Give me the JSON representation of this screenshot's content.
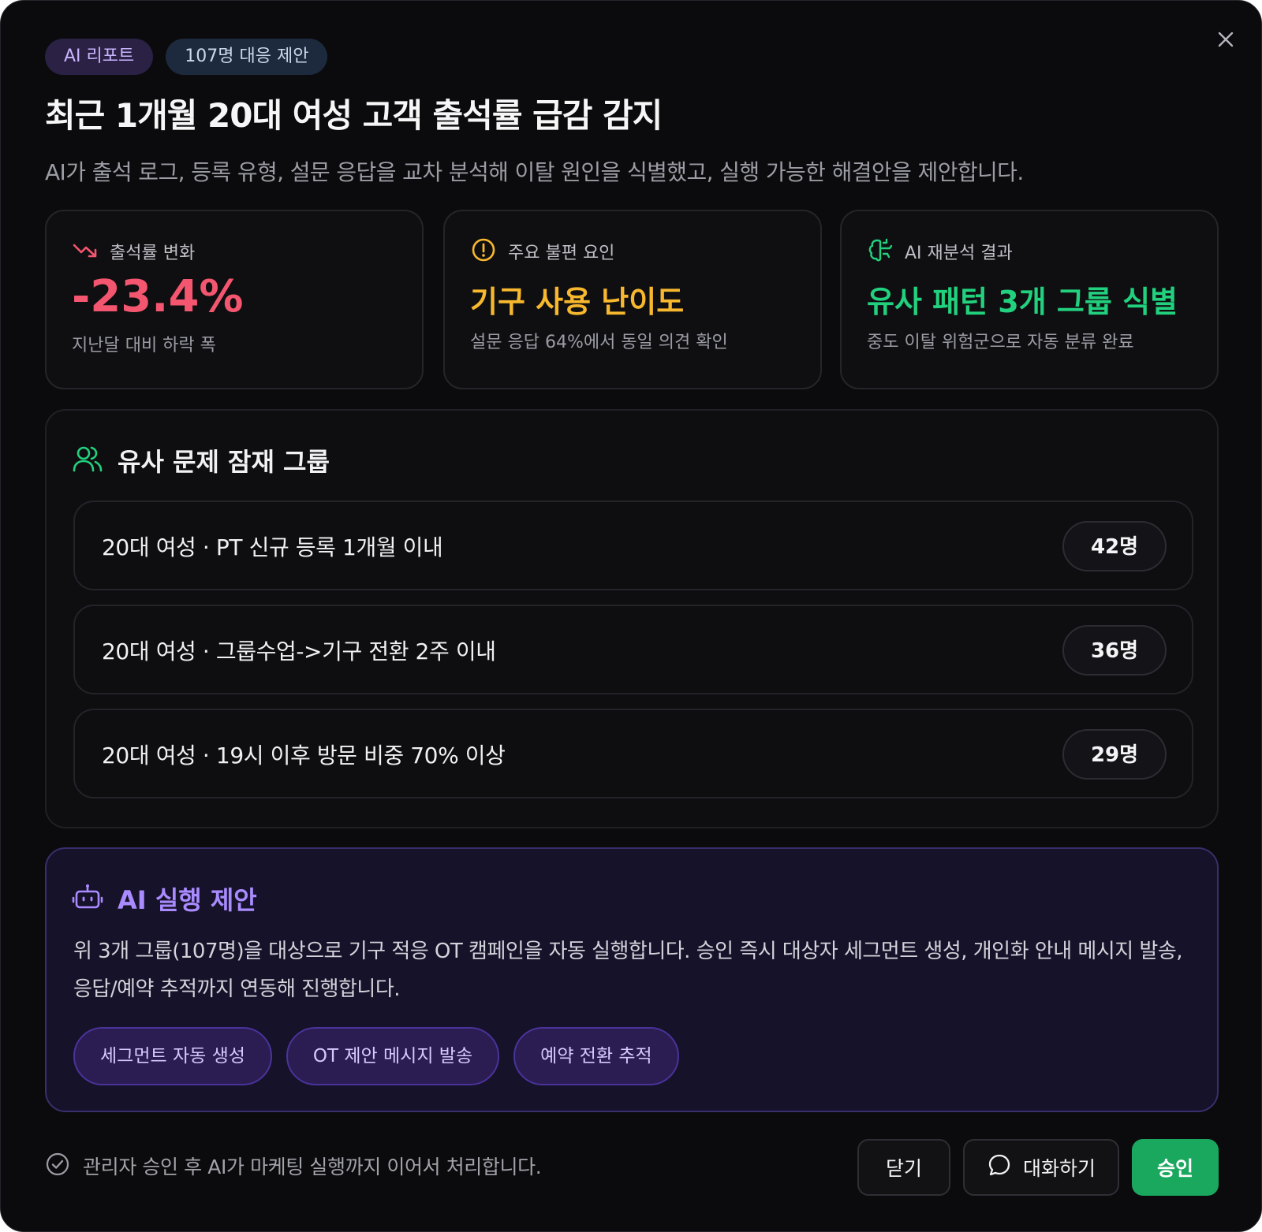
{
  "badges": {
    "ai_report": "AI 리포트",
    "response_count": "107명 대응 제안"
  },
  "header": {
    "title": "최근 1개월 20대 여성 고객 출석률 급감 감지",
    "subtitle": "AI가 출석 로그, 등록 유형, 설문 응답을 교차 분석해 이탈 원인을 식별했고, 실행 가능한 해결안을 제안합니다."
  },
  "stats": [
    {
      "icon": "trend-down-icon",
      "label": "출석률 변화",
      "value": "-23.4%",
      "desc": "지난달 대비 하락 폭",
      "color": "#f4566f"
    },
    {
      "icon": "alert-circle-icon",
      "label": "주요 불편 요인",
      "value": "기구 사용 난이도",
      "desc": "설문 응답 64%에서 동일 의견 확인",
      "color": "#f8b82e"
    },
    {
      "icon": "brain-icon",
      "label": "AI 재분석 결과",
      "value": "유사 패턴 3개 그룹 식별",
      "desc": "중도 이탈 위험군으로 자동 분류 완료",
      "color": "#22d17e"
    }
  ],
  "groups": {
    "title": "유사 문제 잠재 그룹",
    "items": [
      {
        "label": "20대 여성 · PT 신규 등록 1개월 이내",
        "count": "42명"
      },
      {
        "label": "20대 여성 · 그룹수업->기구 전환 2주 이내",
        "count": "36명"
      },
      {
        "label": "20대 여성 · 19시 이후 방문 비중 70% 이상",
        "count": "29명"
      }
    ]
  },
  "ai_exec": {
    "title": "AI 실행 제안",
    "body": "위 3개 그룹(107명)을 대상으로 기구 적응 OT 캠페인을 자동 실행합니다. 승인 즉시 대상자 세그먼트 생성, 개인화 안내 메시지 발송, 응답/예약 추적까지 연동해 진행합니다.",
    "chips": [
      "세그먼트 자동 생성",
      "OT 제안 메시지 발송",
      "예약 전환 추적"
    ]
  },
  "footer": {
    "note": "관리자 승인 후 AI가 마케팅 실행까지 이어서 처리합니다.",
    "close_label": "닫기",
    "chat_label": "대화하기",
    "approve_label": "승인"
  },
  "colors": {
    "accent_purple": "#a98bff",
    "approve_green": "#1aa85e",
    "danger_red": "#f4566f",
    "warning_yellow": "#f8b82e",
    "success_green": "#22d17e"
  }
}
